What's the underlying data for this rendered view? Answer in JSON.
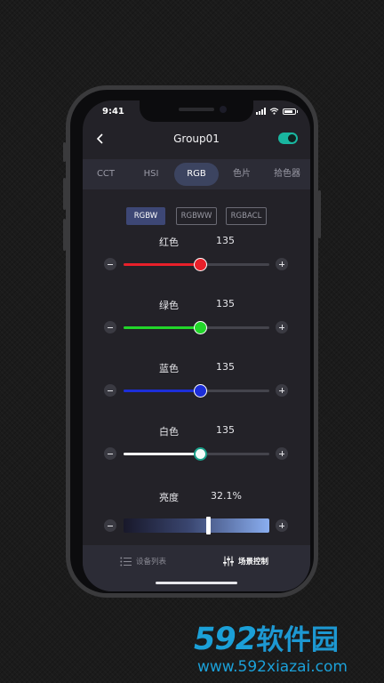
{
  "status": {
    "time": "9:41"
  },
  "header": {
    "title": "Group01",
    "power_on": true
  },
  "tabs": [
    {
      "label": "CCT",
      "active": false
    },
    {
      "label": "HSI",
      "active": false
    },
    {
      "label": "RGB",
      "active": true
    },
    {
      "label": "色片",
      "active": false
    },
    {
      "label": "拾色器",
      "active": false
    }
  ],
  "modes": [
    {
      "label": "RGBW",
      "active": true
    },
    {
      "label": "RGBWW",
      "active": false
    },
    {
      "label": "RGBACL",
      "active": false
    }
  ],
  "sliders": [
    {
      "label": "红色",
      "value": "135",
      "level": 0.53,
      "color": "#e8202a"
    },
    {
      "label": "绿色",
      "value": "135",
      "level": 0.53,
      "color": "#22d62a"
    },
    {
      "label": "蓝色",
      "value": "135",
      "level": 0.53,
      "color": "#1c2ed8"
    },
    {
      "label": "白色",
      "value": "135",
      "level": 0.53,
      "color": "#ffffff"
    }
  ],
  "brightness": {
    "label": "亮度",
    "value": "32.1%",
    "level": 0.58
  },
  "bottom_nav": [
    {
      "label": "设备列表",
      "icon": "list-icon",
      "active": false
    },
    {
      "label": "场景控制",
      "icon": "sliders-icon",
      "active": true
    }
  ],
  "watermark": {
    "logo_digits": "592",
    "logo_text": "软件园",
    "url": "www.592xiazai.com"
  }
}
